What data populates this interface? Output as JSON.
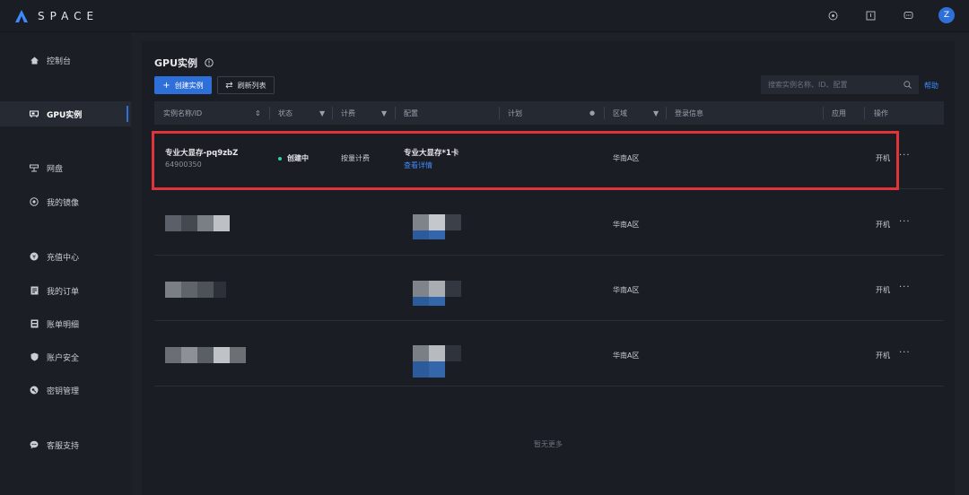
{
  "app": {
    "logo_text": "SPACE",
    "avatar_initial": "Z"
  },
  "sidebar": {
    "items": [
      {
        "label": "控制台",
        "icon": "home-icon"
      },
      {
        "label": "GPU实例",
        "icon": "gpu-icon",
        "active": true
      },
      {
        "label": "网盘",
        "icon": "disk-icon"
      },
      {
        "label": "我的镜像",
        "icon": "image-icon"
      },
      {
        "label": "充值中心",
        "icon": "recharge-icon"
      },
      {
        "label": "我的订单",
        "icon": "order-icon"
      },
      {
        "label": "账单明细",
        "icon": "bill-icon"
      },
      {
        "label": "账户安全",
        "icon": "shield-icon"
      },
      {
        "label": "密钥管理",
        "icon": "key-icon"
      },
      {
        "label": "客服支持",
        "icon": "chat-icon"
      }
    ]
  },
  "page": {
    "title": "GPU实例",
    "create_button": "创建实例",
    "refresh_button": "刷新列表",
    "search_placeholder": "搜索实例名称、ID、配置",
    "help_link": "帮助",
    "empty_text": "暂无更多"
  },
  "table": {
    "columns": [
      "实例名称/ID",
      "状态",
      "计费",
      "配置",
      "计划",
      "区域",
      "登录信息",
      "应用",
      "操作"
    ],
    "rows": [
      {
        "name": "专业大显存-pq9zbZ",
        "id": "64900350",
        "status": "创建中",
        "billing": "按量计费",
        "config": "专业大显存*1卡",
        "config_link": "查看详情",
        "region": "华南A区",
        "action": "开机",
        "more": "···"
      },
      {
        "region": "华南A区",
        "action": "开机",
        "more": "···"
      },
      {
        "region": "华南A区",
        "action": "开机",
        "more": "···"
      },
      {
        "region": "华南A区",
        "action": "开机",
        "more": "···"
      }
    ]
  },
  "colors": {
    "accent": "#2f6fd8",
    "highlight": "#e0343a",
    "status_creating": "#2fd3a0"
  }
}
